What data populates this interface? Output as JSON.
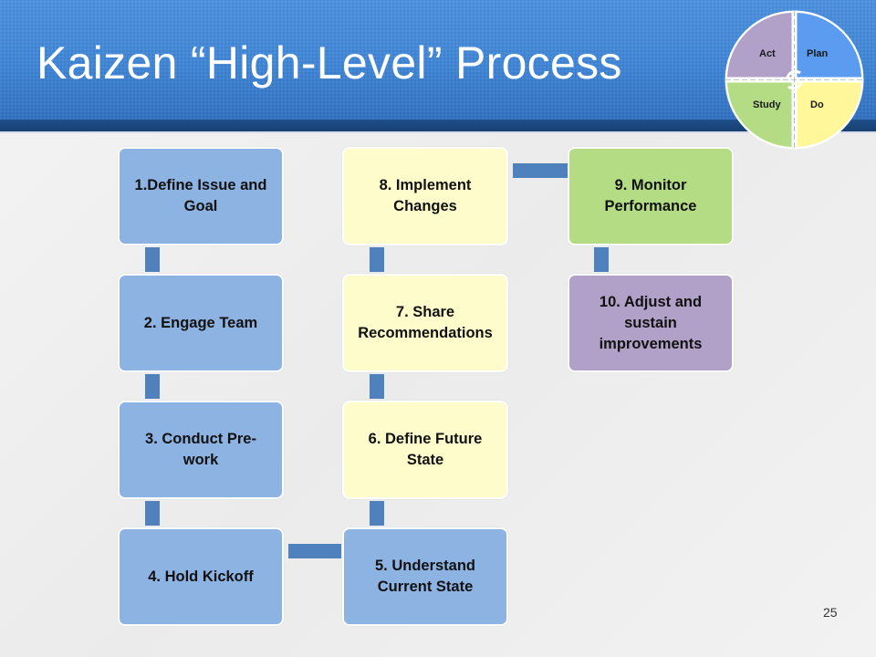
{
  "slide": {
    "title": "Kaizen “High-Level” Process",
    "page_number": "25"
  },
  "pdsa_cycle": {
    "quadrants": [
      {
        "label": "Act",
        "color": "#b1a0c7"
      },
      {
        "label": "Plan",
        "color": "#5b9bf0"
      },
      {
        "label": "Study",
        "color": "#b3dc84"
      },
      {
        "label": "Do",
        "color": "#fff799"
      }
    ],
    "center_icon": "cycle-arrows-icon"
  },
  "steps": [
    {
      "number": 1,
      "label": "1.Define Issue and Goal",
      "color": "#8db3e2"
    },
    {
      "number": 2,
      "label": "2. Engage Team",
      "color": "#8db3e2"
    },
    {
      "number": 3,
      "label": "3. Conduct Pre-work",
      "color": "#8db3e2"
    },
    {
      "number": 4,
      "label": "4. Hold Kickoff",
      "color": "#8db3e2"
    },
    {
      "number": 5,
      "label": "5. Understand Current State",
      "color": "#8db3e2"
    },
    {
      "number": 6,
      "label": "6. Define Future State",
      "color": "#fffccc"
    },
    {
      "number": 7,
      "label": "7. Share Recommendations",
      "color": "#fffccc"
    },
    {
      "number": 8,
      "label": "8. Implement Changes",
      "color": "#fffccc"
    },
    {
      "number": 9,
      "label": "9. Monitor Performance",
      "color": "#b3dc84"
    },
    {
      "number": 10,
      "label": "10. Adjust and sustain improvements",
      "color": "#b1a0c7"
    }
  ],
  "connector_color": "#4f81bd"
}
